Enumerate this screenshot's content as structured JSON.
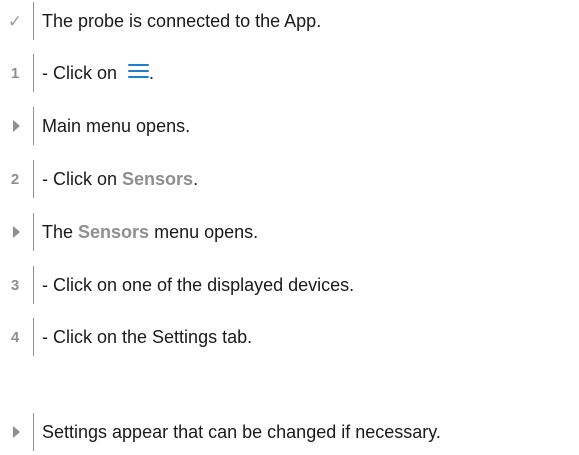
{
  "steps": [
    {
      "marker": "check",
      "text": "The probe is connected to the App."
    },
    {
      "marker": "1",
      "prefix": "- Click on ",
      "icon": "hamburger-menu-icon",
      "suffix": "."
    },
    {
      "marker": "result",
      "text": "Main menu opens."
    },
    {
      "marker": "2",
      "prefix": "- Click on ",
      "keyword": "Sensors",
      "suffix": "."
    },
    {
      "marker": "result",
      "prefix": "The ",
      "keyword": "Sensors",
      "suffix": " menu opens."
    },
    {
      "marker": "3",
      "text": "- Click on one of the displayed devices."
    },
    {
      "marker": "4",
      "text": "- Click on the Settings tab."
    },
    {
      "marker": "result",
      "text": "Settings appear that can be changed if necessary."
    }
  ],
  "colors": {
    "marker_gray": "#8f8f8f",
    "icon_blue": "#1f82c6",
    "text": "#1a1a1a"
  }
}
